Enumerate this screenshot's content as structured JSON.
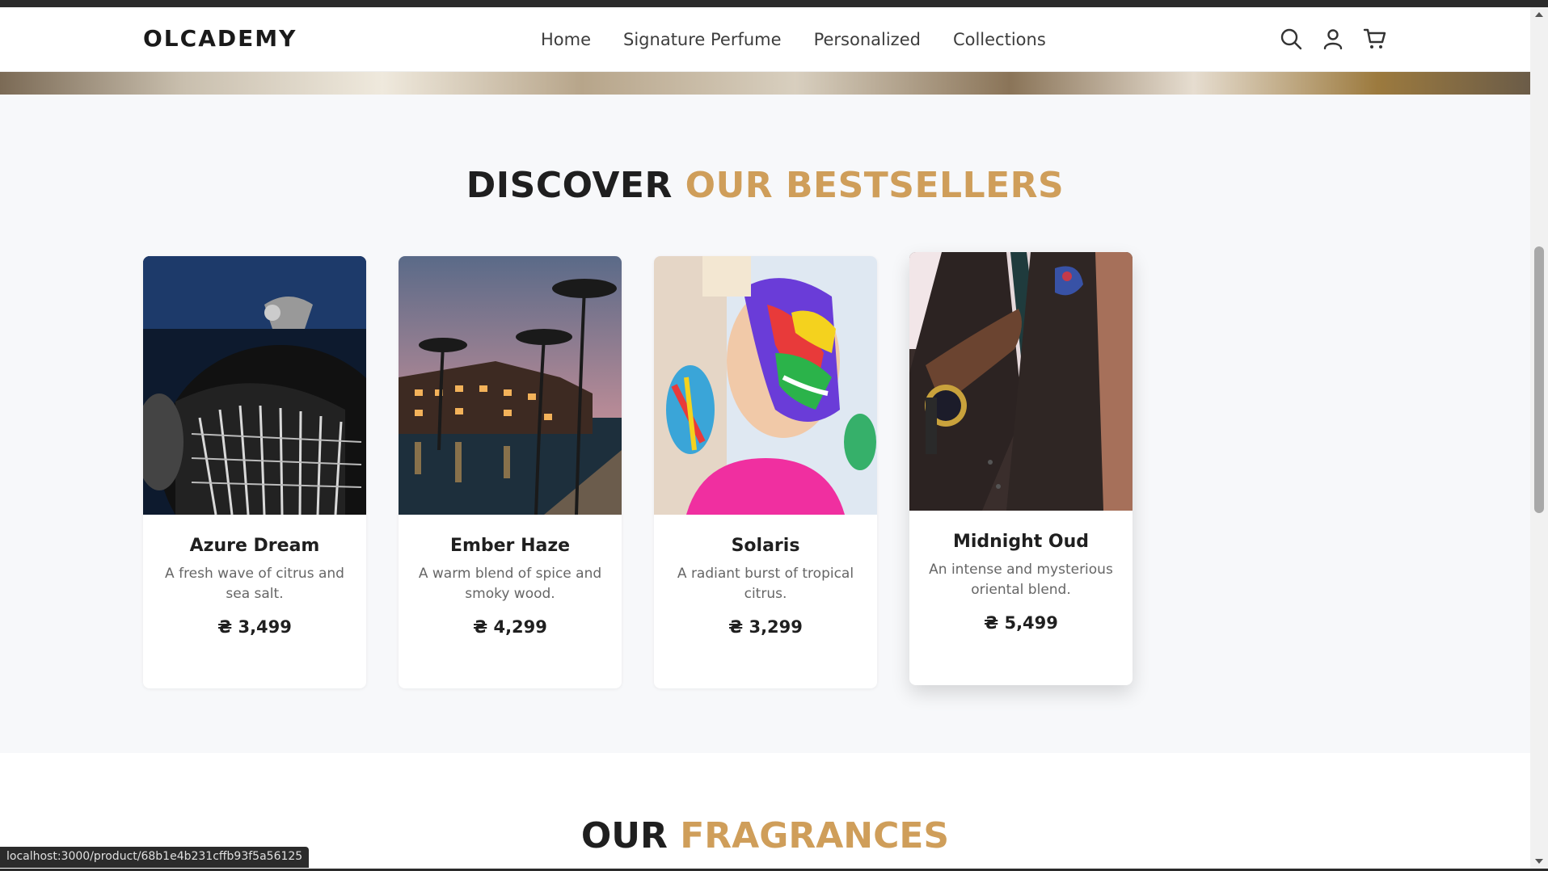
{
  "header": {
    "logo": "OLCADEMY",
    "nav": [
      "Home",
      "Signature Perfume",
      "Personalized",
      "Collections"
    ]
  },
  "bestsellers": {
    "title_part1": "DISCOVER",
    "title_part2": "OUR BESTSELLERS",
    "products": [
      {
        "name": "Azure Dream",
        "desc": "A fresh wave of citrus and sea salt.",
        "price": "₴ 3,499",
        "image": "vintage-car-grille"
      },
      {
        "name": "Ember Haze",
        "desc": "A warm blend of spice and smoky wood.",
        "price": "₴ 4,299",
        "image": "tropical-resort-pool-dusk"
      },
      {
        "name": "Solaris",
        "desc": "A radiant burst of tropical citrus.",
        "price": "₴ 3,299",
        "image": "child-with-colorful-paint"
      },
      {
        "name": "Midnight Oud",
        "desc": "An intense and mysterious oriental blend.",
        "price": "₴ 5,499",
        "image": "man-in-suit-with-watch"
      }
    ]
  },
  "fragrances": {
    "title_part1": "OUR",
    "title_part2": "FRAGRANCES"
  },
  "status_bar": {
    "url": "localhost:3000/product/68b1e4b231cffb93f5a56125"
  },
  "colors": {
    "accent": "#cf9e5a",
    "text": "#1f1f1f",
    "section_bg": "#f7f8fa"
  }
}
